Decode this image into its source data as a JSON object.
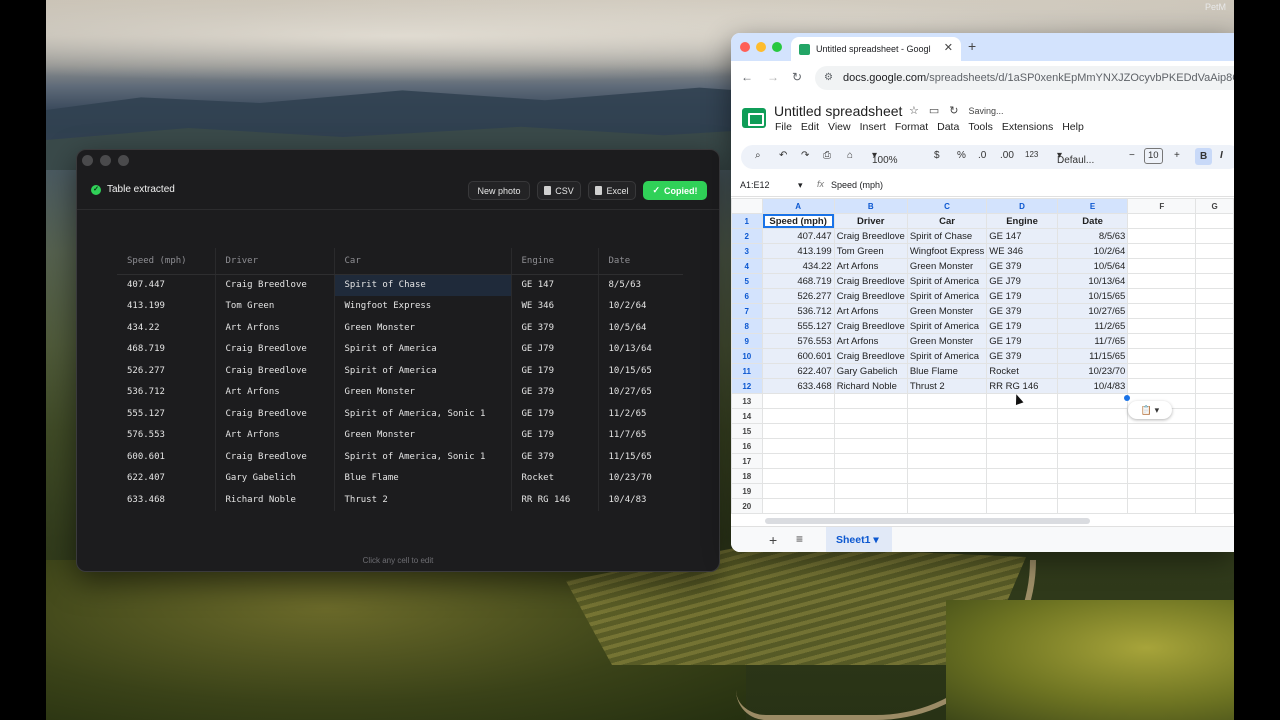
{
  "desktop": {
    "corner_label": "PetM"
  },
  "extractor": {
    "status": "Table extracted",
    "buttons": {
      "new_photo": "New photo",
      "csv": "CSV",
      "excel": "Excel",
      "copied": "Copied!"
    },
    "columns": [
      "Speed (mph)",
      "Driver",
      "Car",
      "Engine",
      "Date"
    ],
    "rows": [
      [
        "407.447",
        "Craig Breedlove",
        "Spirit of Chase",
        "GE 147",
        "8/5/63"
      ],
      [
        "413.199",
        "Tom Green",
        "Wingfoot Express",
        "WE 346",
        "10/2/64"
      ],
      [
        "434.22",
        "Art Arfons",
        "Green Monster",
        "GE 379",
        "10/5/64"
      ],
      [
        "468.719",
        "Craig Breedlove",
        "Spirit of America",
        "GE J79",
        "10/13/64"
      ],
      [
        "526.277",
        "Craig Breedlove",
        "Spirit of America",
        "GE 179",
        "10/15/65"
      ],
      [
        "536.712",
        "Art Arfons",
        "Green Monster",
        "GE 379",
        "10/27/65"
      ],
      [
        "555.127",
        "Craig Breedlove",
        "Spirit of America, Sonic 1",
        "GE 179",
        "11/2/65"
      ],
      [
        "576.553",
        "Art Arfons",
        "Green Monster",
        "GE 179",
        "11/7/65"
      ],
      [
        "600.601",
        "Craig Breedlove",
        "Spirit of America, Sonic 1",
        "GE 379",
        "11/15/65"
      ],
      [
        "622.407",
        "Gary Gabelich",
        "Blue Flame",
        "Rocket",
        "10/23/70"
      ],
      [
        "633.468",
        "Richard Noble",
        "Thrust 2",
        "RR RG 146",
        "10/4/83"
      ]
    ],
    "footer_hint": "Click any cell to edit"
  },
  "browser": {
    "tab_title": "Untitled spreadsheet - Googl",
    "url_host": "docs.google.com",
    "url_path": "/spreadsheets/d/1aSP0xenkEpMmYNXJZOcyvbPKEDdVaAip8OWp",
    "doc_title": "Untitled spreadsheet",
    "saving": "Saving...",
    "menu": [
      "File",
      "Edit",
      "View",
      "Insert",
      "Format",
      "Data",
      "Tools",
      "Extensions",
      "Help"
    ],
    "toolbar": {
      "zoom": "100%",
      "currency": "$",
      "percent": "%",
      "dec_down": ".0",
      "dec_up": ".00",
      "num_fmt": "123",
      "font": "Defaul...",
      "font_size": "10",
      "bold": "B",
      "italic": "I"
    },
    "name_box": "A1:E12",
    "formula": "Speed (mph)",
    "col_letters": [
      "A",
      "B",
      "C",
      "D",
      "E",
      "F",
      "G"
    ],
    "row_numbers": [
      "1",
      "2",
      "3",
      "4",
      "5",
      "6",
      "7",
      "8",
      "9",
      "10",
      "11",
      "12",
      "13",
      "14",
      "15",
      "16",
      "17",
      "18",
      "19",
      "20"
    ],
    "sheet_rows": [
      [
        "Speed (mph)",
        "Driver",
        "Car",
        "Engine",
        "Date"
      ],
      [
        "407.447",
        "Craig Breedlove",
        "Spirit of Chase",
        "GE 147",
        "8/5/63"
      ],
      [
        "413.199",
        "Tom Green",
        "Wingfoot Express",
        "WE 346",
        "10/2/64"
      ],
      [
        "434.22",
        "Art Arfons",
        "Green Monster",
        "GE 379",
        "10/5/64"
      ],
      [
        "468.719",
        "Craig Breedlove",
        "Spirit of America",
        "GE J79",
        "10/13/64"
      ],
      [
        "526.277",
        "Craig Breedlove",
        "Spirit of America",
        "GE 179",
        "10/15/65"
      ],
      [
        "536.712",
        "Art Arfons",
        "Green Monster",
        "GE 379",
        "10/27/65"
      ],
      [
        "555.127",
        "Craig Breedlove",
        "Spirit of America",
        "GE 179",
        "11/2/65"
      ],
      [
        "576.553",
        "Art Arfons",
        "Green Monster",
        "GE 179",
        "11/7/65"
      ],
      [
        "600.601",
        "Craig Breedlove",
        "Spirit of America",
        "GE 379",
        "11/15/65"
      ],
      [
        "622.407",
        "Gary Gabelich",
        "Blue Flame",
        "Rocket",
        "10/23/70"
      ],
      [
        "633.468",
        "Richard Noble",
        "Thrust 2",
        "RR RG 146",
        "10/4/83"
      ]
    ],
    "sheet_tab": "Sheet1"
  }
}
